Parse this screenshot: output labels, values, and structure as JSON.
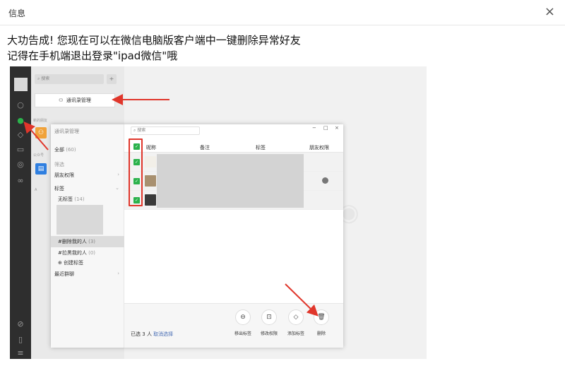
{
  "dialog": {
    "title": "信息",
    "close_glyph": "×",
    "message_line1": "大功告成! 您现在可以在微信电脑版客户端中一键删除异常好友",
    "message_line2": "记得在手机端退出登录\"ipad微信\"哦"
  },
  "wechat": {
    "search_placeholder": "搜索",
    "add_glyph": "+",
    "manage_button": "通讯录管理",
    "manage_icon": "contacts-icon",
    "sections": {
      "new_friends": "新的朋友",
      "official": "公众号",
      "letter_a": "A"
    },
    "rail_icons": [
      "chat-icon",
      "contacts-icon",
      "favorites-icon",
      "files-icon",
      "moments-icon",
      "miniprogram-icon",
      "link-icon",
      "phone-icon",
      "menu-icon"
    ],
    "accent_color": "#2bb24c",
    "annotation_color": "#e0362b"
  },
  "manager": {
    "title": "通讯录管理",
    "all": "全部",
    "all_count": "(60)",
    "filter": "筛选",
    "friend_perm": "朋友权限",
    "tags": "标签",
    "no_tag": "无标签",
    "no_tag_count": "(14)",
    "deleted_me": "#删除我的人",
    "deleted_me_count": "(3)",
    "blocked_me": "#拉黑我的人",
    "blocked_me_count": "(0)",
    "create_tag": "创建标签",
    "recent_groups": "最近群聊",
    "search_placeholder": "搜索",
    "window_controls": [
      "−",
      "□",
      "×"
    ],
    "columns": [
      "昵称",
      "备注",
      "标签",
      "朋友权限"
    ],
    "row_checked_glyph": "✓",
    "selected_prefix": "已选",
    "selected_count": "3",
    "selected_suffix": "人",
    "deselect": "取消选择",
    "actions": [
      {
        "label": "移出标签",
        "icon": "remove-tag-icon",
        "glyph": "⊖"
      },
      {
        "label": "修改权限",
        "icon": "lock-icon",
        "glyph": "⊡"
      },
      {
        "label": "添加标签",
        "icon": "tag-icon",
        "glyph": "◇"
      },
      {
        "label": "删除",
        "icon": "trash-icon",
        "glyph": "🗑"
      }
    ]
  }
}
